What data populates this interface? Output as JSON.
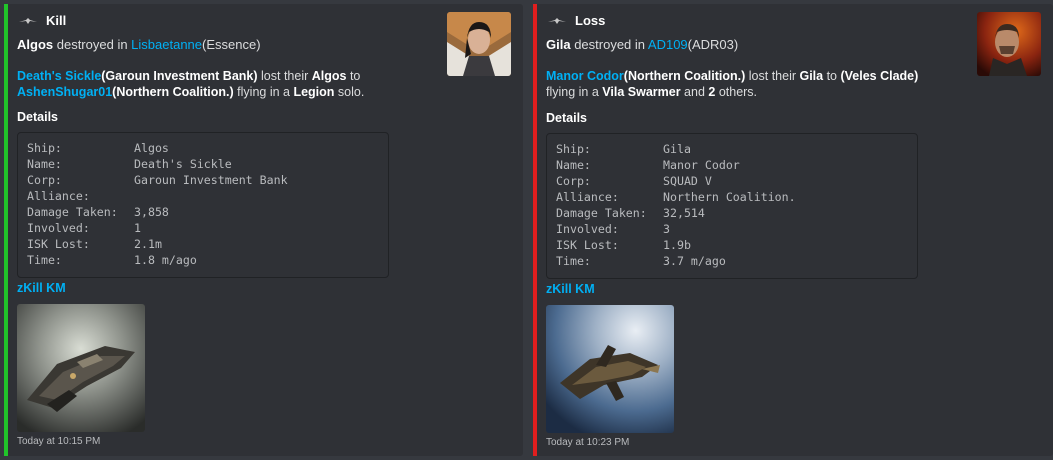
{
  "colors": {
    "kill": "#21c42a",
    "loss": "#e01e1e",
    "link": "#00b0f4"
  },
  "kill": {
    "author": "Kill",
    "author_icon": "eve-wings-icon",
    "title": {
      "ship": "Algos",
      "mid": " destroyed in ",
      "system": "Lisbaetanne",
      "region": "(Essence)"
    },
    "desc": {
      "victim": "Death's Sickle",
      "victim_corp": "(Garoun Investment Bank)",
      "t1": " lost their ",
      "ship": "Algos",
      "t2": " to",
      "attacker": "AshenShugar01",
      "attacker_corp": "(Northern Coalition.)",
      "t3": " flying in a ",
      "attacker_ship": "Legion",
      "t4": " solo."
    },
    "details_label": "Details",
    "details": [
      {
        "k": "Ship:",
        "v": "Algos"
      },
      {
        "k": "Name:",
        "v": "Death's Sickle"
      },
      {
        "k": "Corp:",
        "v": "Garoun Investment Bank"
      },
      {
        "k": "Alliance:",
        "v": ""
      },
      {
        "k": "Damage Taken:",
        "v": "3,858"
      },
      {
        "k": "Involved:",
        "v": "1"
      },
      {
        "k": "ISK Lost:",
        "v": "2.1m"
      },
      {
        "k": "Time:",
        "v": "1.8 m/ago"
      }
    ],
    "zkill_label": "zKill KM",
    "footer": "Today at 10:15 PM"
  },
  "loss": {
    "author": "Loss",
    "author_icon": "eve-wings-icon",
    "title": {
      "ship": "Gila",
      "mid": " destroyed in ",
      "system": "AD109",
      "region": "(ADR03)"
    },
    "desc": {
      "victim": "Manor Codor",
      "victim_corp": "(Northern Coalition.)",
      "t1": " lost their ",
      "ship": "Gila",
      "t2": " to ",
      "attacker_corp": "(Veles Clade)",
      "t3": "flying in a ",
      "attacker_ship": "Vila Swarmer",
      "t4": " and ",
      "others_count": "2",
      "t5": " others."
    },
    "details_label": "Details",
    "details": [
      {
        "k": "Ship:",
        "v": "Gila"
      },
      {
        "k": "Name:",
        "v": "Manor Codor"
      },
      {
        "k": "Corp:",
        "v": "SQUAD V"
      },
      {
        "k": "Alliance:",
        "v": "Northern Coalition."
      },
      {
        "k": "Damage Taken:",
        "v": "32,514"
      },
      {
        "k": "Involved:",
        "v": "3"
      },
      {
        "k": "ISK Lost:",
        "v": "1.9b"
      },
      {
        "k": "Time:",
        "v": "3.7 m/ago"
      }
    ],
    "zkill_label": "zKill KM",
    "footer": "Today at 10:23 PM"
  }
}
